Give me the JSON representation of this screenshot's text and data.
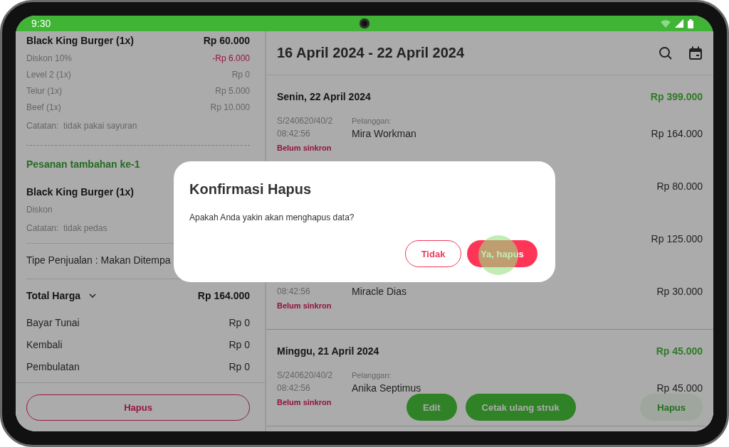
{
  "status_bar": {
    "time": "9:30"
  },
  "order_panel": {
    "items": [
      {
        "name": "Black King Burger (1x)",
        "price": "Rp 60.000",
        "modifiers": [
          {
            "label": "Diskon 10%",
            "value": "-Rp 6.000",
            "kind": "discount"
          },
          {
            "label": "Level 2 (1x)",
            "value": "Rp 0",
            "kind": "normal"
          },
          {
            "label": "Telur (1x)",
            "value": "Rp 5.000",
            "kind": "normal"
          },
          {
            "label": "Beef (1x)",
            "value": "Rp 10.000",
            "kind": "normal"
          }
        ],
        "note": "Catatan:  tidak pakai sayuran"
      }
    ],
    "additional_orders": [
      {
        "title": "Pesanan tambahan ke-1",
        "items": [
          {
            "name": "Black King Burger (1x)",
            "modifiers": [
              {
                "label": "Diskon"
              }
            ],
            "note": "Catatan:  tidak pedas"
          }
        ]
      }
    ],
    "sales_type": "Tipe Penjualan : Makan Ditempa",
    "total": {
      "label": "Total Harga",
      "value": "Rp 164.000"
    },
    "payments": [
      {
        "label": "Bayar Tunai",
        "value": "Rp 0"
      },
      {
        "label": "Kembali",
        "value": "Rp 0"
      },
      {
        "label": "Pembulatan",
        "value": "Rp 0"
      }
    ],
    "delete_button": "Hapus"
  },
  "history_panel": {
    "title": "16 April 2024 - 22 April 2024",
    "days": [
      {
        "date": "Senin, 22 April 2024",
        "total": "Rp 399.000",
        "transactions": [
          {
            "receipt_no": "S/240620/40/2",
            "time": "08:42:56",
            "customer_label": "Pelanggan:",
            "customer": "Mira Workman",
            "amount": "Rp 164.000",
            "status": "Belum sinkron"
          },
          {
            "amount": "Rp 80.000"
          },
          {
            "amount": "Rp 125.000"
          },
          {
            "time": "08:42:56",
            "customer": "Miracle Dias",
            "amount": "Rp 30.000",
            "status": "Belum sinkron"
          }
        ]
      },
      {
        "date": "Minggu, 21 April 2024",
        "total": "Rp 45.000",
        "transactions": [
          {
            "receipt_no": "S/240620/40/2",
            "time": "08:42:56",
            "customer_label": "Pelanggan:",
            "customer": "Anika Septimus",
            "amount": "Rp 45.000",
            "status": "Belum sinkron"
          }
        ]
      }
    ],
    "actions": [
      {
        "label": "Edit",
        "kind": "primary"
      },
      {
        "label": "Cetak ulang struk",
        "kind": "primary"
      },
      {
        "label": "Hapus",
        "kind": "soft"
      }
    ]
  },
  "dialog": {
    "title": "Konfirmasi Hapus",
    "message": "Apakah Anda yakin akan menghapus data?",
    "buttons": [
      {
        "label": "Tidak",
        "kind": "outline"
      },
      {
        "label": "Ya, hapus",
        "kind": "filled"
      }
    ]
  }
}
